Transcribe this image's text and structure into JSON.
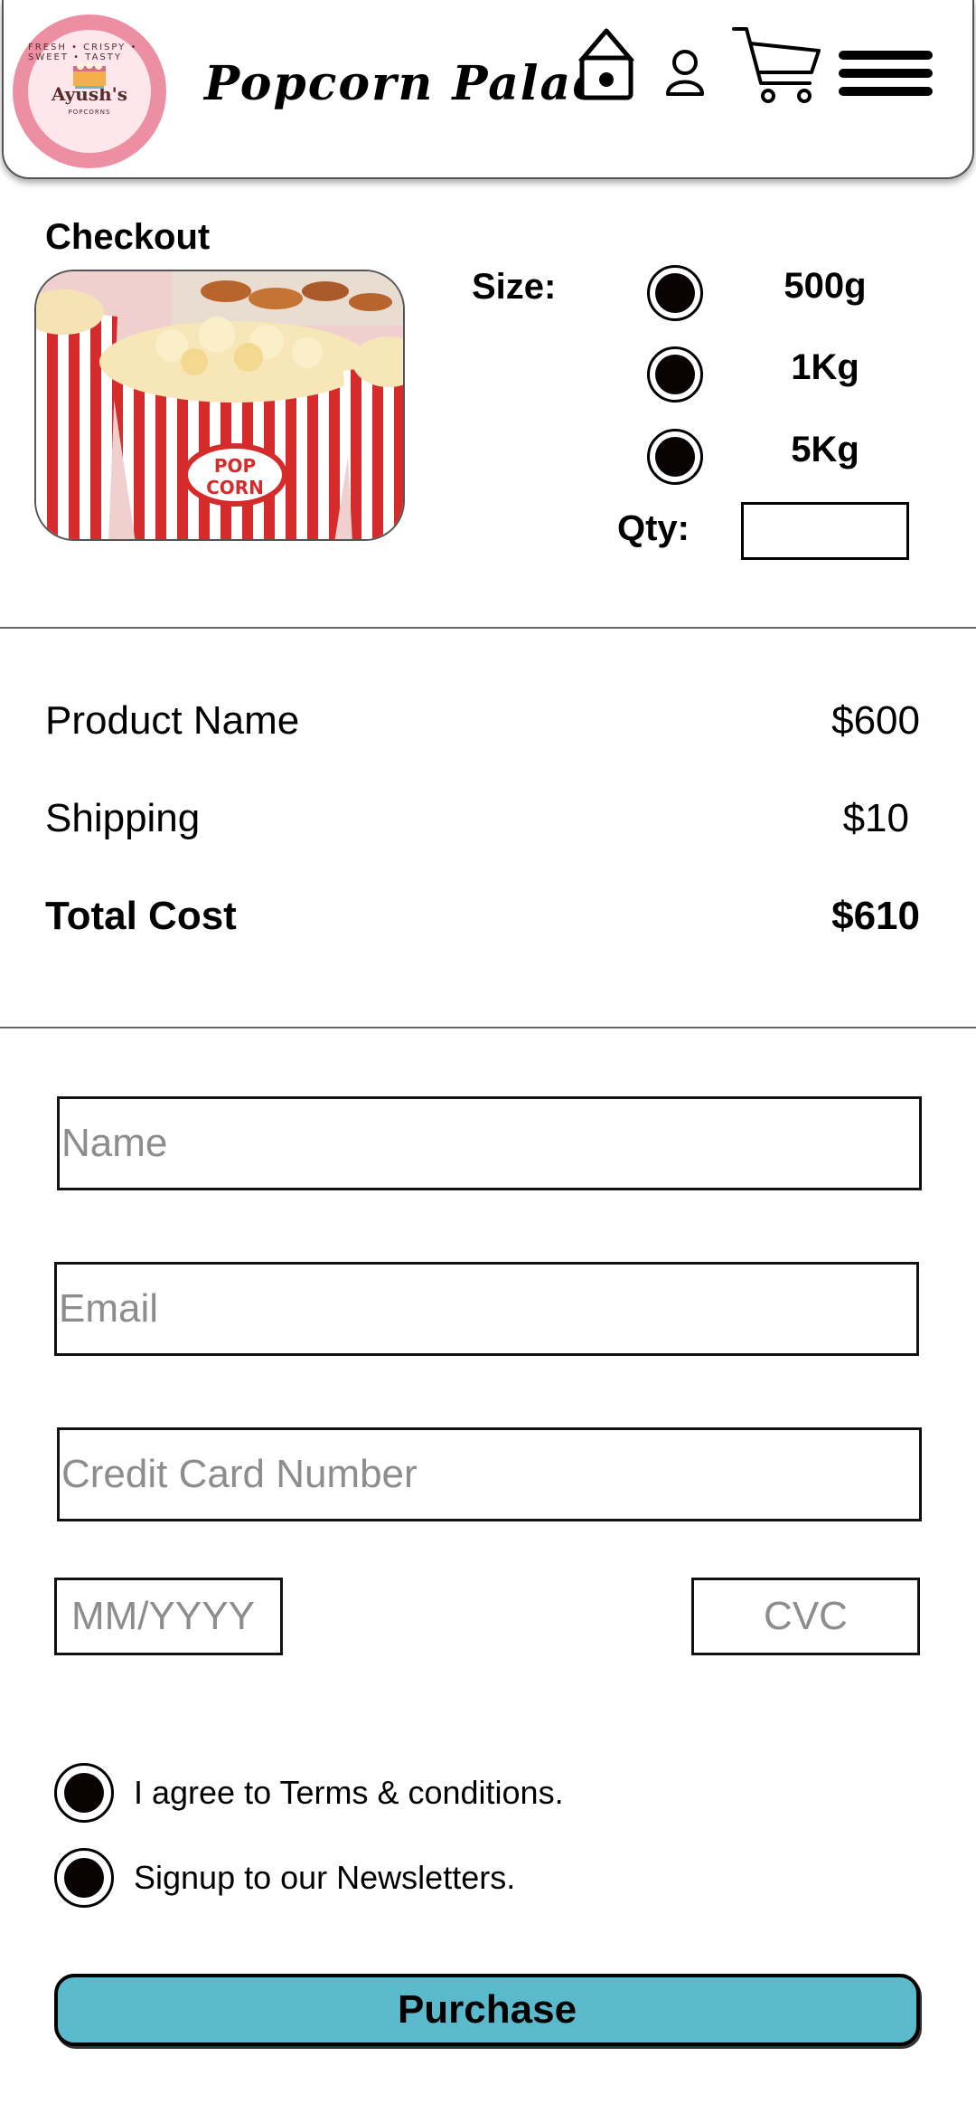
{
  "header": {
    "brand_title": "Popcorn Palace",
    "logo": {
      "name": "Ayush's",
      "tagline": "FRESH • CRISPY • SWEET • TASTY",
      "sub": "POPCORNS"
    },
    "icons": [
      "home-icon",
      "user-icon",
      "cart-icon",
      "menu-icon"
    ]
  },
  "checkout": {
    "title": "Checkout",
    "size_label": "Size:",
    "size_options": [
      "500g",
      "1Kg",
      "5Kg"
    ],
    "qty_label": "Qty:",
    "qty_value": ""
  },
  "summary": {
    "rows": [
      {
        "label": "Product Name",
        "value": "$600"
      },
      {
        "label": "Shipping",
        "value": "$10"
      },
      {
        "label": "Total Cost",
        "value": "$610"
      }
    ]
  },
  "form": {
    "name_placeholder": "Name",
    "email_placeholder": "Email",
    "card_placeholder": "Credit Card Number",
    "expiry_placeholder": "MM/YYYY",
    "cvc_placeholder": "CVC",
    "terms_label": "I agree to Terms & conditions.",
    "newsletter_label": "Signup to our Newsletters.",
    "purchase_label": "Purchase"
  },
  "colors": {
    "logo_ring": "#ec8fa3",
    "purchase_button": "#5bb9cc",
    "popcorn_stripe": "#d62b2b"
  }
}
